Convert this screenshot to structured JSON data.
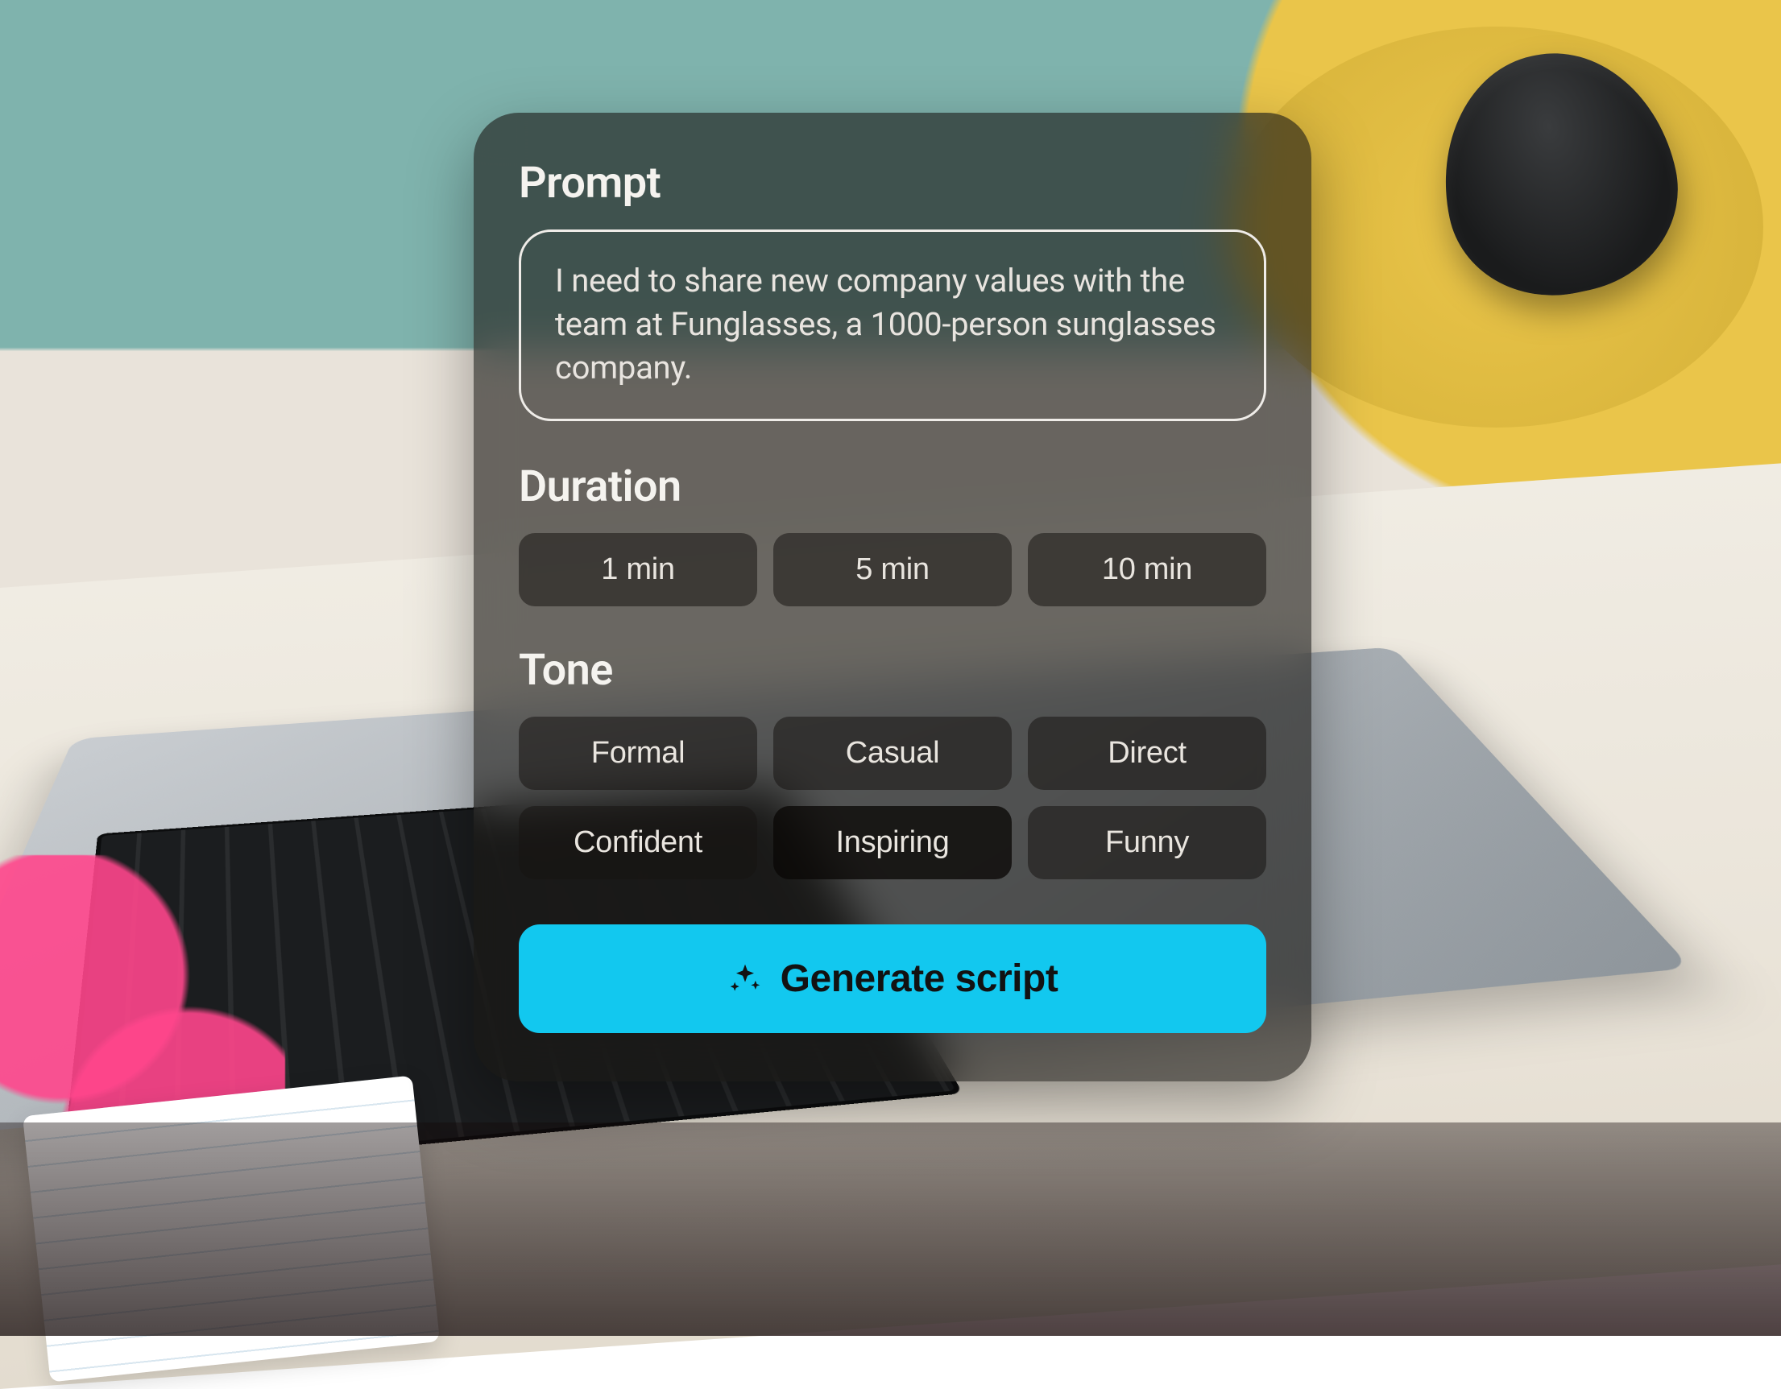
{
  "prompt": {
    "title": "Prompt",
    "text": "I need to share new company values with the team at Funglasses, a 1000-person sunglasses company."
  },
  "duration": {
    "title": "Duration",
    "options": [
      "1 min",
      "5 min",
      "10 min"
    ],
    "selected": null
  },
  "tone": {
    "title": "Tone",
    "options": [
      "Formal",
      "Casual",
      "Direct",
      "Confident",
      "Inspiring",
      "Funny"
    ],
    "selected": "Inspiring"
  },
  "generate": {
    "label": "Generate script",
    "icon": "sparkle-icon"
  },
  "colors": {
    "accent": "#12c8ef",
    "card_bg": "rgba(25,22,20,0.62)",
    "text": "#efece8"
  }
}
